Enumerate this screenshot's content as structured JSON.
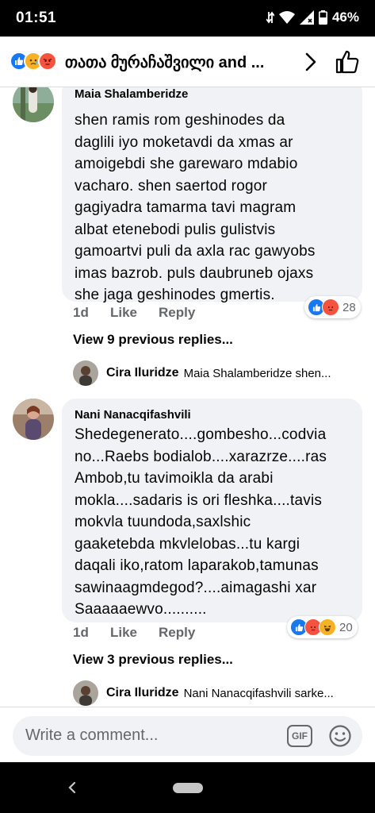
{
  "status_bar": {
    "time": "01:51",
    "battery": "46%"
  },
  "header": {
    "title": "თათა მურაჩაშვილი and ...",
    "reaction_icons": [
      "like-reaction-icon",
      "sad-reaction-icon",
      "angry-reaction-icon"
    ]
  },
  "comments": [
    {
      "author": "Maia Shalamberidze",
      "text": "shen ramis rom geshinodes da\ndaglili iyo moketavdi da xmas ar\namoigebdi she garewaro mdabio\nvacharo. shen saertod rogor\ngagiyadra tamarma tavi magram\nalbat etenebodi pulis gulistvis\ngamoartvi puli da axla rac gawyobs\nimas bazrob. puls daubruneb ojaxs\nshe jaga geshinodes gmertis.",
      "time": "1d",
      "like_label": "Like",
      "reply_label": "Reply",
      "reaction_count": "28",
      "reactions": [
        "like",
        "angry"
      ],
      "view_previous": "View 9 previous replies...",
      "reply": {
        "author": "Cira Iluridze",
        "snippet": "Maia Shalamberidze shen..."
      }
    },
    {
      "author": "Nani Nanacqifashvili",
      "text": "Shedegenerato....gombesho...codvia\nno...Raebs bodialob....xarazrze....ras\nAmbob,tu tavimoikla da arabi\nmokla....sadaris is ori fleshka....tavis\nmokvla tuundoda,saxlshic\ngaaketebda mkvlelobas...tu kargi\ndaqali iko,ratom laparakob,tamunas\nsawinaagmdegod?....aimagashi xar\nSaaaaaewvo..........",
      "time": "1d",
      "like_label": "Like",
      "reply_label": "Reply",
      "reaction_count": "20",
      "reactions": [
        "like",
        "angry",
        "haha"
      ],
      "view_previous": "View 3 previous replies...",
      "reply": {
        "author": "Cira Iluridze",
        "snippet": "Nani Nanacqifashvili sarke..."
      }
    }
  ],
  "composer": {
    "placeholder": "Write a comment...",
    "gif_label": "GIF"
  },
  "colors": {
    "like_blue": "#1877f2",
    "angry_orange": "#f5533d",
    "haha_yellow": "#f7b125",
    "bubble_gray": "#f0f2f5",
    "meta_gray": "#65676b"
  }
}
